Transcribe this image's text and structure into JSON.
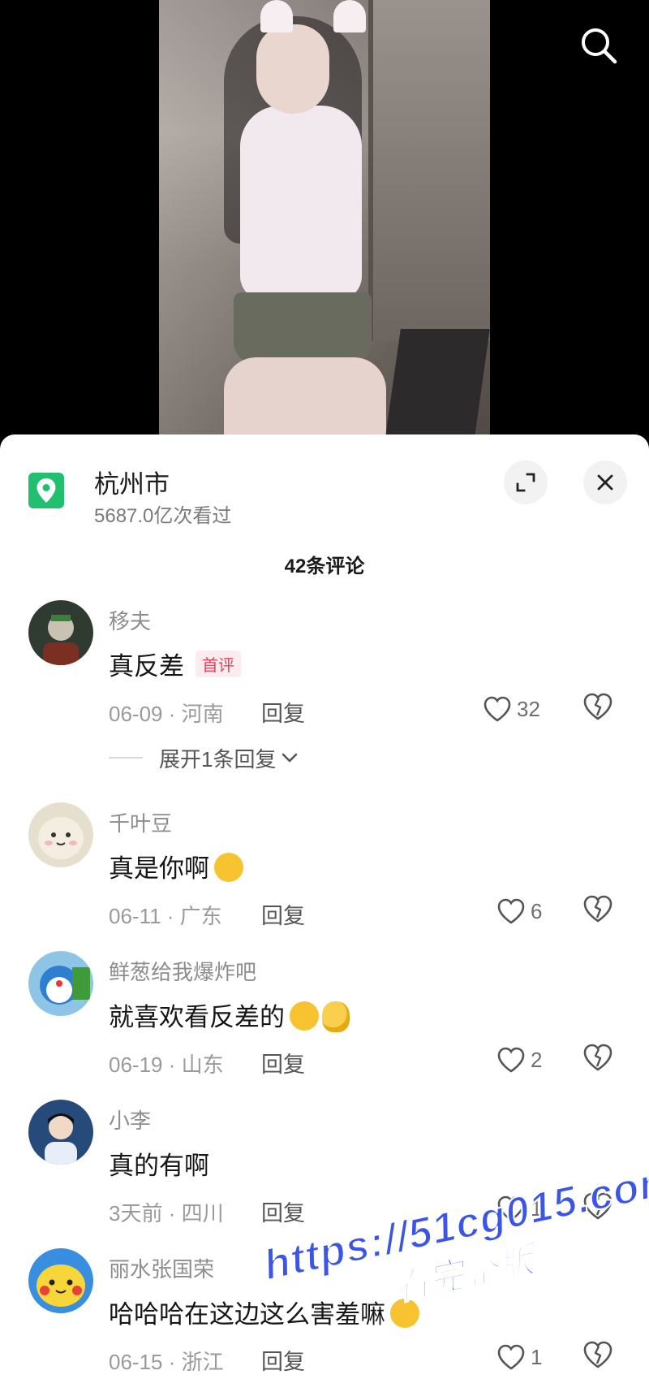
{
  "location": {
    "title": "杭州市",
    "views": "5687.0亿次看过"
  },
  "comments_header": {
    "count_label": "42条评论"
  },
  "comments": [
    {
      "user": "移夫",
      "text": "真反差",
      "tag": "首评",
      "meta": "06-09 · 河南",
      "reply_label": "回复",
      "likes": "32",
      "avatar_color": "#3a4a3a"
    },
    {
      "user": "千叶豆",
      "text": "真是你啊",
      "meta": "06-11 · 广东",
      "reply_label": "回复",
      "likes": "6",
      "avatar_color": "#e8e0cf"
    },
    {
      "user": "鲜葱给我爆炸吧",
      "text": "就喜欢看反差的",
      "meta": "06-19 · 山东",
      "reply_label": "回复",
      "likes": "2",
      "avatar_color": "#4f86c6"
    },
    {
      "user": "小李",
      "text": "真的有啊",
      "meta": "3天前 · 四川",
      "reply_label": "回复",
      "likes": "1",
      "avatar_color": "#1f3f6b"
    },
    {
      "user": "丽水张国荣",
      "text": "哈哈哈在这边这么害羞嘛",
      "meta": "06-15 · 浙江",
      "reply_label": "回复",
      "likes": "1",
      "avatar_color": "#3d8de0"
    }
  ],
  "expand_replies": {
    "label": "展开1条回复"
  },
  "watermark": {
    "url": "https://51cg015.com",
    "sub": "看完整版"
  },
  "icons": {
    "search": "search-icon",
    "location": "location-pin-icon",
    "expand": "expand-icon",
    "close": "close-icon",
    "like": "heart-icon",
    "dislike": "broken-heart-icon",
    "chevron": "chevron-down-icon"
  },
  "colors": {
    "accent_tag": "#e8405d",
    "location_green": "#21c071",
    "watermark_blue": "#3b56e6"
  }
}
